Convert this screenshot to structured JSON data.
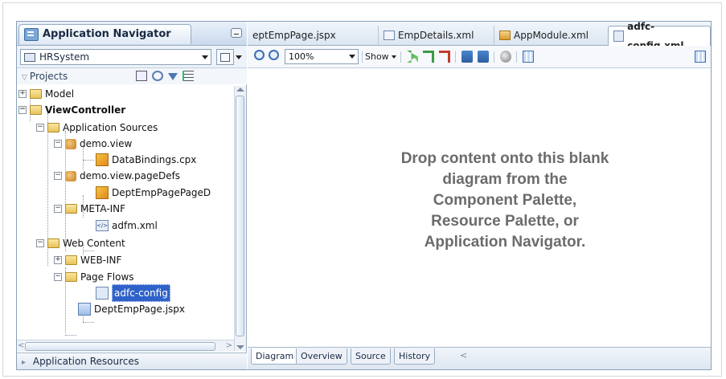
{
  "navigator": {
    "title": "Application Navigator",
    "workspace": "HRSystem",
    "projects_label": "Projects",
    "app_resources": "Application Resources",
    "tree": [
      {
        "label": "Model"
      },
      {
        "label": "ViewController"
      },
      {
        "label": "Application Sources"
      },
      {
        "label": "demo.view"
      },
      {
        "label": "DataBindings.cpx"
      },
      {
        "label": "demo.view.pageDefs"
      },
      {
        "label": "DeptEmpPagePageD"
      },
      {
        "label": "META-INF"
      },
      {
        "label": "adfm.xml"
      },
      {
        "label": "Web Content"
      },
      {
        "label": "WEB-INF"
      },
      {
        "label": "Page Flows"
      },
      {
        "label": "adfc-config"
      },
      {
        "label": "DeptEmpPage.jspx"
      }
    ]
  },
  "editor": {
    "tabs": [
      {
        "label": "eptEmpPage.jspx"
      },
      {
        "label": "EmpDetails.xml"
      },
      {
        "label": "AppModule.xml"
      },
      {
        "label": "adfc-config.xml"
      }
    ],
    "zoom": "100%",
    "show_label": "Show",
    "message": [
      "Drop content onto this blank",
      "diagram from the",
      "Component Palette,",
      "Resource Palette, or",
      "Application Navigator."
    ],
    "bottom_tabs": [
      {
        "label": "Diagram"
      },
      {
        "label": "Overview"
      },
      {
        "label": "Source"
      },
      {
        "label": "History"
      }
    ]
  }
}
